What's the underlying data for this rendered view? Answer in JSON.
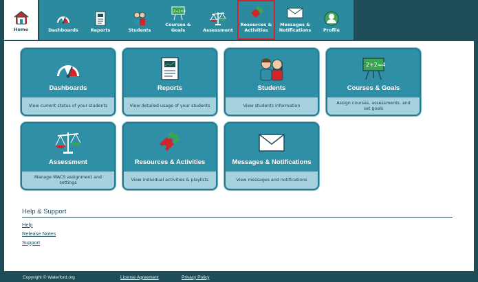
{
  "nav": {
    "home": "Home",
    "dashboards": "Dashboards",
    "reports": "Reports",
    "students": "Students",
    "courses": "Courses & Goals",
    "assessment": "Assessment",
    "resources_l1": "Resources &",
    "resources_l2": "Activities",
    "messages_l1": "Messages &",
    "messages_l2": "Notifications",
    "profile": "Profile"
  },
  "cards": {
    "dashboards": {
      "title": "Dashboards",
      "desc": "View current status of your students"
    },
    "reports": {
      "title": "Reports",
      "desc": "View detailed usage of your students"
    },
    "students": {
      "title": "Students",
      "desc": "View students information"
    },
    "courses": {
      "title": "Courses & Goals",
      "desc": "Assign courses, assessments, and set goals"
    },
    "assessment": {
      "title": "Assessment",
      "desc": "Manage WACS assignment and settings"
    },
    "resources": {
      "title": "Resources & Activities",
      "desc": "View individual activities & playlists"
    },
    "messages": {
      "title": "Messages & Notifications",
      "desc": "View messages and notifications"
    }
  },
  "help": {
    "title": "Help & Support",
    "links": [
      "Help",
      "Release Notes",
      "Support"
    ]
  },
  "footer": {
    "copyright": "Copyright © Waterford.org",
    "license": "License Agreement",
    "privacy": "Privacy Policy"
  },
  "colors": {
    "brand_dark": "#1f4d57",
    "card": "#2f8fa6",
    "card_desc": "#a6d2df",
    "highlight": "#d0262b"
  },
  "icons": [
    "home-icon",
    "speedometer-icon",
    "report-icon",
    "students-icon",
    "chalkboard-icon",
    "scale-icon",
    "puzzle-icon",
    "envelope-icon",
    "profile-icon"
  ]
}
